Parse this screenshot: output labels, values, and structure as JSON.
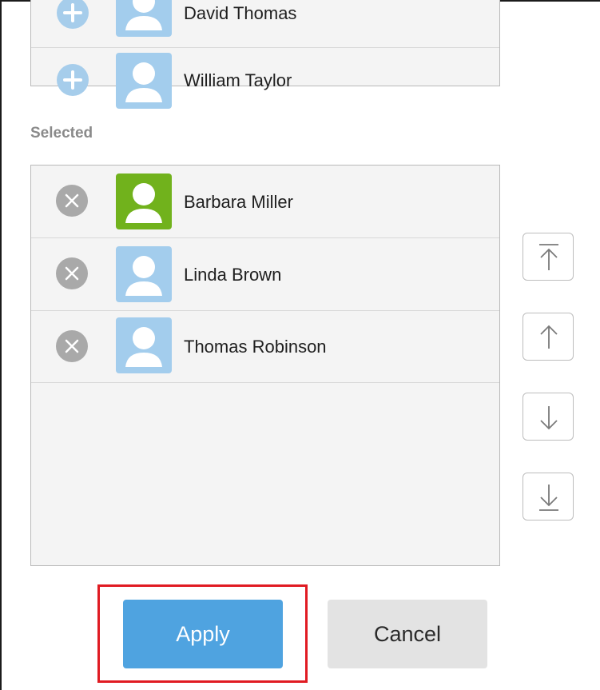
{
  "available_list": {
    "members": [
      {
        "name": "David Thomas"
      },
      {
        "name": "William Taylor"
      }
    ]
  },
  "selected_section": {
    "label": "Selected",
    "members": [
      {
        "name": "Barbara Miller",
        "avatar_color": "#71b21c"
      },
      {
        "name": "Linda Brown",
        "avatar_color": "#a3cded"
      },
      {
        "name": "Thomas Robinson",
        "avatar_color": "#a3cded"
      }
    ]
  },
  "order_controls": [
    {
      "icon": "move-to-top-icon"
    },
    {
      "icon": "move-up-icon"
    },
    {
      "icon": "move-down-icon"
    },
    {
      "icon": "move-to-bottom-icon"
    }
  ],
  "actions": {
    "apply_label": "Apply",
    "cancel_label": "Cancel"
  },
  "colors": {
    "apply_button": "#4fa3e0",
    "highlight": "#e01b22",
    "default_avatar": "#a3cded"
  }
}
